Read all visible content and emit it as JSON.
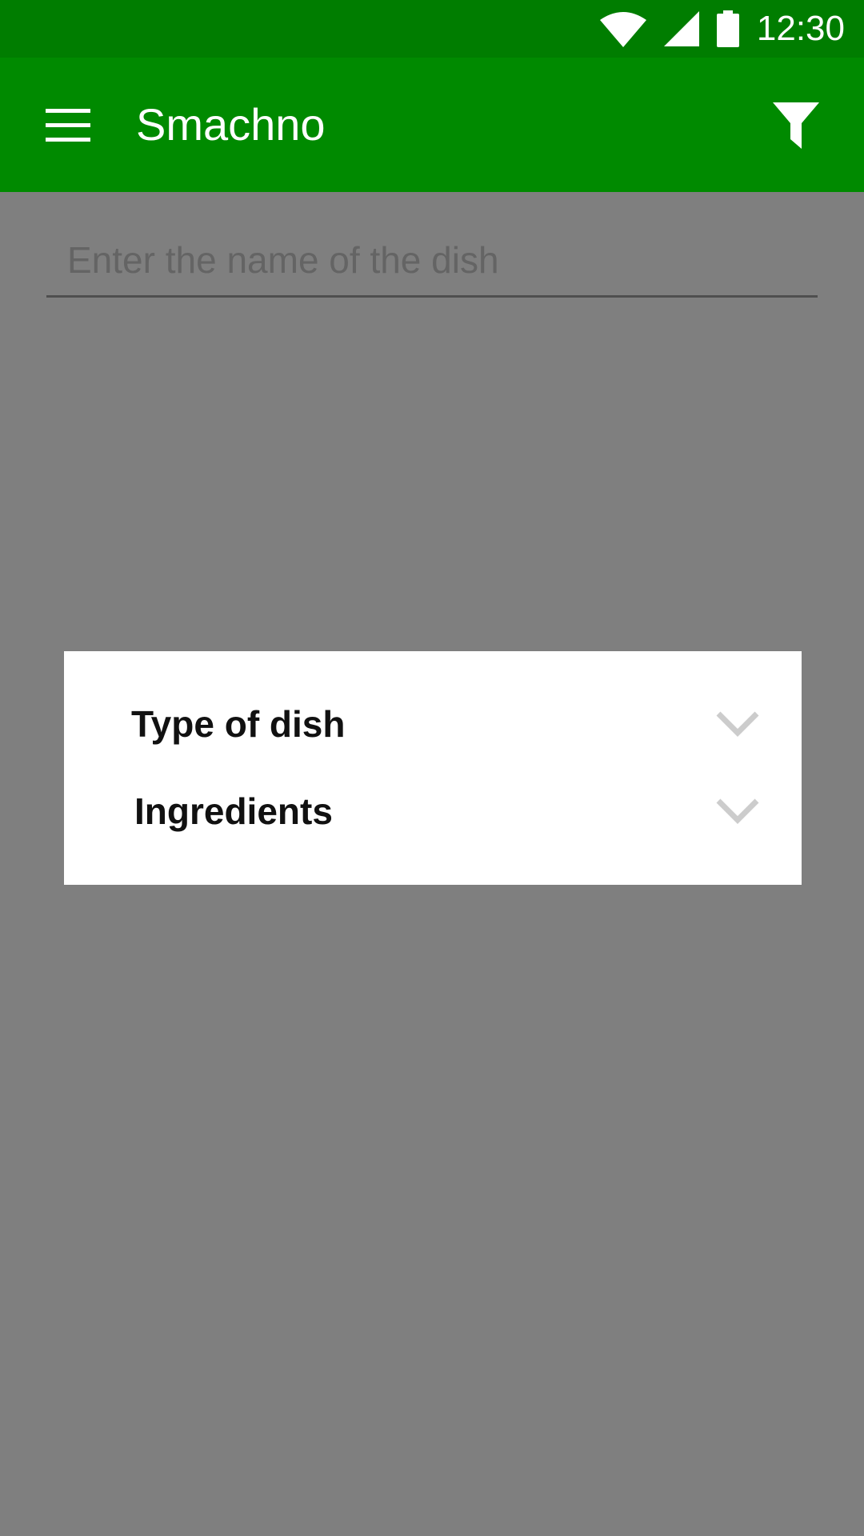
{
  "status_bar": {
    "time": "12:30",
    "icons": [
      "wifi-icon",
      "cellular-signal-icon",
      "battery-icon"
    ]
  },
  "app_bar": {
    "title": "Smachno",
    "menu_icon": "hamburger-menu-icon",
    "filter_icon": "filter-icon"
  },
  "search": {
    "placeholder": "Enter the name of the dish",
    "value": ""
  },
  "filter_dialog": {
    "items": [
      {
        "label": "Type of dish",
        "icon": "chevron-down-icon"
      },
      {
        "label": "Ingredients",
        "icon": "chevron-down-icon"
      }
    ]
  },
  "colors": {
    "status_bar": "#007d00",
    "app_bar": "#008a00",
    "scrim": "#808080",
    "dialog": "#ffffff",
    "chevron": "#cccccc"
  }
}
